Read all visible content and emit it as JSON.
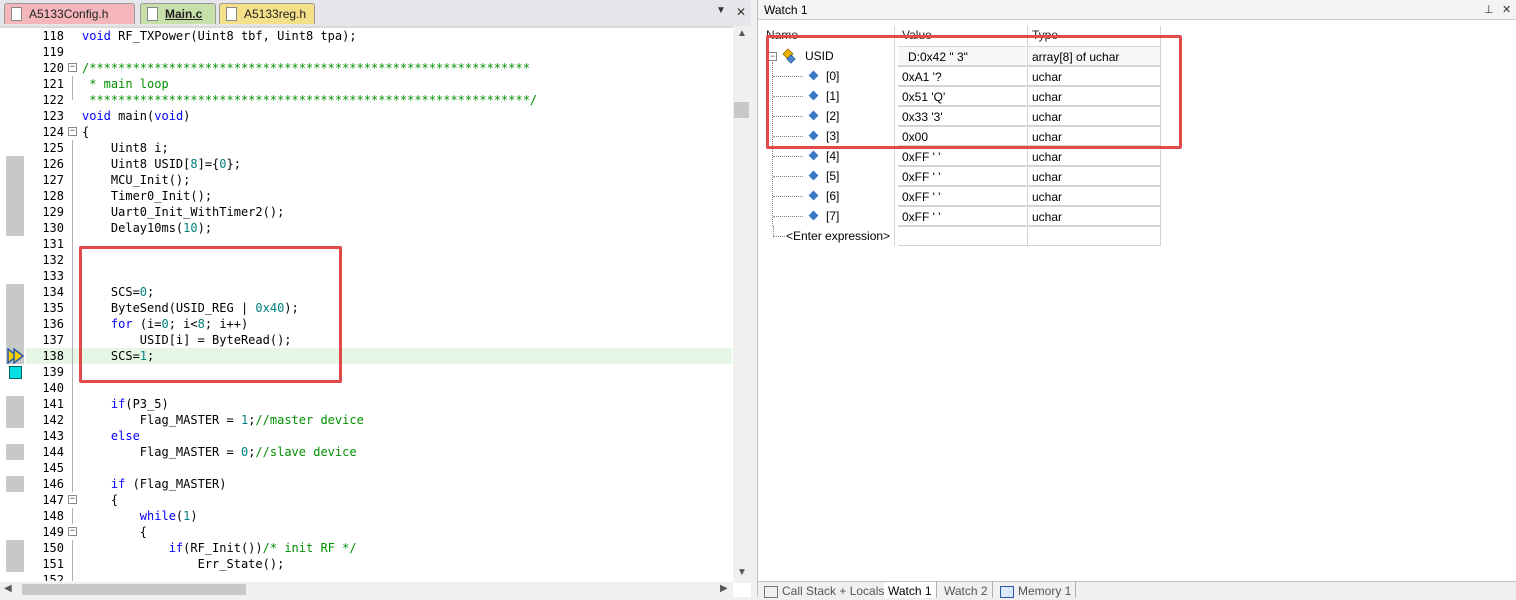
{
  "editor": {
    "tabs": [
      {
        "label": "A5133Config.h",
        "color": "#f4b6bb"
      },
      {
        "label": "Main.c",
        "color": "#c7dfa9"
      },
      {
        "label": "A5133reg.h",
        "color": "#f5e08a"
      }
    ],
    "tab_menu_icon": "▼",
    "tab_close_icon": "✕",
    "lines": [
      {
        "n": "118",
        "t": "void RF_TXPower(Uint8 tbf, Uint8 tpa);"
      },
      {
        "n": "119",
        "t": ""
      },
      {
        "n": "120",
        "t": "/*************************************************************"
      },
      {
        "n": "121",
        "t": " * main loop"
      },
      {
        "n": "122",
        "t": " *************************************************************/"
      },
      {
        "n": "123",
        "t": "void main(void)"
      },
      {
        "n": "124",
        "t": "{"
      },
      {
        "n": "125",
        "t": "    Uint8 i;"
      },
      {
        "n": "126",
        "t": "    Uint8 USID[8]={0};"
      },
      {
        "n": "127",
        "t": "    MCU_Init();"
      },
      {
        "n": "128",
        "t": "    Timer0_Init();"
      },
      {
        "n": "129",
        "t": "    Uart0_Init_WithTimer2();"
      },
      {
        "n": "130",
        "t": "    Delay10ms(10);"
      },
      {
        "n": "131",
        "t": ""
      },
      {
        "n": "132",
        "t": ""
      },
      {
        "n": "133",
        "t": ""
      },
      {
        "n": "134",
        "t": "    SCS=0;"
      },
      {
        "n": "135",
        "t": "    ByteSend(USID_REG | 0x40);"
      },
      {
        "n": "136",
        "t": "    for (i=0; i<8; i++)"
      },
      {
        "n": "137",
        "t": "        USID[i] = ByteRead();"
      },
      {
        "n": "138",
        "t": "    SCS=1;"
      },
      {
        "n": "139",
        "t": ""
      },
      {
        "n": "140",
        "t": ""
      },
      {
        "n": "141",
        "t": "    if(P3_5)"
      },
      {
        "n": "142",
        "t": "        Flag_MASTER = 1;//master device"
      },
      {
        "n": "143",
        "t": "    else"
      },
      {
        "n": "144",
        "t": "        Flag_MASTER = 0;//slave device"
      },
      {
        "n": "145",
        "t": ""
      },
      {
        "n": "146",
        "t": "    if (Flag_MASTER)"
      },
      {
        "n": "147",
        "t": "    {"
      },
      {
        "n": "148",
        "t": "        while(1)"
      },
      {
        "n": "149",
        "t": "        {"
      },
      {
        "n": "150",
        "t": "            if(RF_Init())/* init RF */"
      },
      {
        "n": "151",
        "t": "                Err_State();"
      },
      {
        "n": "152",
        "t": ""
      }
    ]
  },
  "watch": {
    "title": "Watch 1",
    "pin_icon": "⊥",
    "close_icon": "✕",
    "columns": {
      "name": "Name",
      "value": "Value",
      "type": "Type"
    },
    "root": {
      "name": "USID",
      "value": "D:0x42 \"    3\"",
      "type": "array[8] of uchar"
    },
    "items": [
      {
        "name": "[0]",
        "value": "0xA1 '?",
        "type": "uchar"
      },
      {
        "name": "[1]",
        "value": "0x51 'Q'",
        "type": "uchar"
      },
      {
        "name": "[2]",
        "value": "0x33 '3'",
        "type": "uchar"
      },
      {
        "name": "[3]",
        "value": "0x00",
        "type": "uchar"
      },
      {
        "name": "[4]",
        "value": "0xFF '    '",
        "type": "uchar"
      },
      {
        "name": "[5]",
        "value": "0xFF '    '",
        "type": "uchar"
      },
      {
        "name": "[6]",
        "value": "0xFF '    '",
        "type": "uchar"
      },
      {
        "name": "[7]",
        "value": "0xFF '    '",
        "type": "uchar"
      }
    ],
    "enter_expression": "<Enter expression>"
  },
  "bottom_tabs": [
    {
      "label": "Call Stack + Locals"
    },
    {
      "label": "Watch 1"
    },
    {
      "label": "Watch 2"
    },
    {
      "label": "Memory 1"
    }
  ],
  "colors": {
    "highlight_box": "#e04a4a",
    "current_line": "#e6f7e6",
    "comment": "#009000",
    "keyword": "#0000ff",
    "number": "#008080"
  }
}
